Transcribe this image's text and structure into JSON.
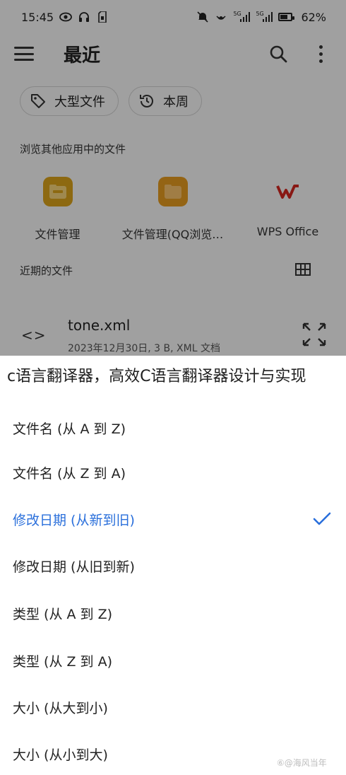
{
  "status_bar": {
    "time": "15:45",
    "signal_1": "5G",
    "signal_2": "5G",
    "battery_level": 0.62,
    "battery_text": "62%"
  },
  "app_bar": {
    "title": "最近"
  },
  "filter_chips": [
    {
      "label": "大型文件",
      "icon": "tag-icon"
    },
    {
      "label": "本周",
      "icon": "history-icon"
    }
  ],
  "browse_section": {
    "label": "浏览其他应用中的文件",
    "apps": [
      {
        "label": "文件管理",
        "icon_color": "#d9a21b"
      },
      {
        "label": "文件管理(QQ浏览…",
        "icon_color": "#e39a1f"
      },
      {
        "label": "WPS Office",
        "icon_color": "#d2261f"
      }
    ]
  },
  "recent_section": {
    "label": "近期的文件",
    "files": [
      {
        "name": "tone.xml",
        "meta": "2023年12月30日, 3 B, XML 文档"
      }
    ]
  },
  "sort_sheet": {
    "title": "c语言翻译器，高效C语言翻译器设计与实现",
    "selected_color": "#2a6fdb",
    "options": [
      {
        "label": "文件名 (从 A 到 Z)",
        "selected": false
      },
      {
        "label": "文件名 (从 Z 到 A)",
        "selected": false
      },
      {
        "label": "修改日期 (从新到旧)",
        "selected": true
      },
      {
        "label": "修改日期 (从旧到新)",
        "selected": false
      },
      {
        "label": "类型 (从 A 到 Z)",
        "selected": false
      },
      {
        "label": "类型 (从 Z 到 A)",
        "selected": false
      },
      {
        "label": "大小 (从大到小)",
        "selected": false
      },
      {
        "label": "大小 (从小到大)",
        "selected": false
      }
    ]
  },
  "watermark": "⑥@海风当年"
}
